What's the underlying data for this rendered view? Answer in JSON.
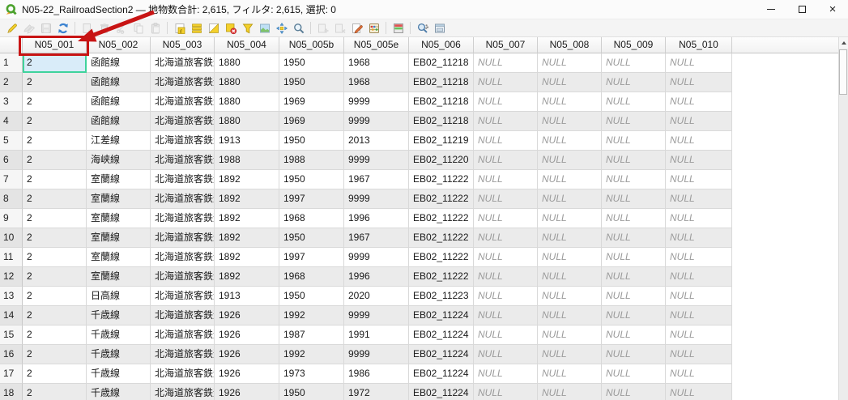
{
  "window": {
    "title": "N05-22_RailroadSection2 — 地物数合計: 2,615, フィルタ: 2,615, 選択: 0",
    "app_icon": "qgis-logo-icon"
  },
  "toolbar": {
    "buttons": [
      {
        "id": "toggle-editing-mode",
        "icon": "pencil",
        "enabled": true
      },
      {
        "id": "toggle-multi-edit-mode",
        "icon": "pencil-multi",
        "enabled": false
      },
      {
        "id": "save-edits",
        "icon": "save",
        "enabled": false
      },
      {
        "id": "reload-table",
        "icon": "refresh",
        "enabled": true
      },
      {
        "id": "separator"
      },
      {
        "id": "add-feature",
        "icon": "add-feature",
        "enabled": false
      },
      {
        "id": "delete-selected-features",
        "icon": "trash",
        "enabled": false
      },
      {
        "id": "cut-features",
        "icon": "scissors",
        "enabled": false
      },
      {
        "id": "copy-features",
        "icon": "copy",
        "enabled": false
      },
      {
        "id": "paste-features",
        "icon": "paste",
        "enabled": false
      },
      {
        "id": "separator"
      },
      {
        "id": "select-by-expression",
        "icon": "epsilon",
        "enabled": true
      },
      {
        "id": "select-all",
        "icon": "select-all",
        "enabled": true
      },
      {
        "id": "invert-selection",
        "icon": "invert",
        "enabled": true
      },
      {
        "id": "deselect-all",
        "icon": "deselect",
        "enabled": true
      },
      {
        "id": "filter-features",
        "icon": "funnel",
        "enabled": true
      },
      {
        "id": "move-selection-to-top",
        "icon": "map",
        "enabled": true
      },
      {
        "id": "pan-map-to-selected",
        "icon": "pan",
        "enabled": true
      },
      {
        "id": "zoom-map-to-selected",
        "icon": "magnifier",
        "enabled": true
      },
      {
        "id": "separator"
      },
      {
        "id": "new-field",
        "icon": "field-add",
        "enabled": false
      },
      {
        "id": "delete-field",
        "icon": "field-delete",
        "enabled": false
      },
      {
        "id": "edit-field",
        "icon": "pencil-paper",
        "enabled": true
      },
      {
        "id": "field-calculator",
        "icon": "abacus",
        "enabled": true
      },
      {
        "id": "separator"
      },
      {
        "id": "conditional-formatting",
        "icon": "cond-format",
        "enabled": true
      },
      {
        "id": "separator"
      },
      {
        "id": "actions",
        "icon": "magnifier-gear",
        "enabled": true
      },
      {
        "id": "dock-attribute-table",
        "icon": "dock",
        "enabled": true
      }
    ]
  },
  "table": {
    "columns": [
      "N05_001",
      "N05_002",
      "N05_003",
      "N05_004",
      "N05_005b",
      "N05_005e",
      "N05_006",
      "N05_007",
      "N05_008",
      "N05_009",
      "N05_010"
    ],
    "null_display": "NULL",
    "rows": [
      {
        "num": "1",
        "cells": [
          "2",
          "函館線",
          "北海道旅客鉄道...",
          "1880",
          "1950",
          "1968",
          "EB02_11218",
          "NULL",
          "NULL",
          "NULL",
          "NULL"
        ]
      },
      {
        "num": "2",
        "cells": [
          "2",
          "函館線",
          "北海道旅客鉄道...",
          "1880",
          "1950",
          "1968",
          "EB02_11218",
          "NULL",
          "NULL",
          "NULL",
          "NULL"
        ]
      },
      {
        "num": "3",
        "cells": [
          "2",
          "函館線",
          "北海道旅客鉄道...",
          "1880",
          "1969",
          "9999",
          "EB02_11218",
          "NULL",
          "NULL",
          "NULL",
          "NULL"
        ]
      },
      {
        "num": "4",
        "cells": [
          "2",
          "函館線",
          "北海道旅客鉄道...",
          "1880",
          "1969",
          "9999",
          "EB02_11218",
          "NULL",
          "NULL",
          "NULL",
          "NULL"
        ]
      },
      {
        "num": "5",
        "cells": [
          "2",
          "江差線",
          "北海道旅客鉄道...",
          "1913",
          "1950",
          "2013",
          "EB02_11219",
          "NULL",
          "NULL",
          "NULL",
          "NULL"
        ]
      },
      {
        "num": "6",
        "cells": [
          "2",
          "海峡線",
          "北海道旅客鉄道...",
          "1988",
          "1988",
          "9999",
          "EB02_11220",
          "NULL",
          "NULL",
          "NULL",
          "NULL"
        ]
      },
      {
        "num": "7",
        "cells": [
          "2",
          "室蘭線",
          "北海道旅客鉄道...",
          "1892",
          "1950",
          "1967",
          "EB02_11222",
          "NULL",
          "NULL",
          "NULL",
          "NULL"
        ]
      },
      {
        "num": "8",
        "cells": [
          "2",
          "室蘭線",
          "北海道旅客鉄道...",
          "1892",
          "1997",
          "9999",
          "EB02_11222",
          "NULL",
          "NULL",
          "NULL",
          "NULL"
        ]
      },
      {
        "num": "9",
        "cells": [
          "2",
          "室蘭線",
          "北海道旅客鉄道...",
          "1892",
          "1968",
          "1996",
          "EB02_11222",
          "NULL",
          "NULL",
          "NULL",
          "NULL"
        ]
      },
      {
        "num": "10",
        "cells": [
          "2",
          "室蘭線",
          "北海道旅客鉄道...",
          "1892",
          "1950",
          "1967",
          "EB02_11222",
          "NULL",
          "NULL",
          "NULL",
          "NULL"
        ]
      },
      {
        "num": "11",
        "cells": [
          "2",
          "室蘭線",
          "北海道旅客鉄道...",
          "1892",
          "1997",
          "9999",
          "EB02_11222",
          "NULL",
          "NULL",
          "NULL",
          "NULL"
        ]
      },
      {
        "num": "12",
        "cells": [
          "2",
          "室蘭線",
          "北海道旅客鉄道...",
          "1892",
          "1968",
          "1996",
          "EB02_11222",
          "NULL",
          "NULL",
          "NULL",
          "NULL"
        ]
      },
      {
        "num": "13",
        "cells": [
          "2",
          "日高線",
          "北海道旅客鉄道...",
          "1913",
          "1950",
          "2020",
          "EB02_11223",
          "NULL",
          "NULL",
          "NULL",
          "NULL"
        ]
      },
      {
        "num": "14",
        "cells": [
          "2",
          "千歳線",
          "北海道旅客鉄道...",
          "1926",
          "1992",
          "9999",
          "EB02_11224",
          "NULL",
          "NULL",
          "NULL",
          "NULL"
        ]
      },
      {
        "num": "15",
        "cells": [
          "2",
          "千歳線",
          "北海道旅客鉄道...",
          "1926",
          "1987",
          "1991",
          "EB02_11224",
          "NULL",
          "NULL",
          "NULL",
          "NULL"
        ]
      },
      {
        "num": "16",
        "cells": [
          "2",
          "千歳線",
          "北海道旅客鉄道...",
          "1926",
          "1992",
          "9999",
          "EB02_11224",
          "NULL",
          "NULL",
          "NULL",
          "NULL"
        ]
      },
      {
        "num": "17",
        "cells": [
          "2",
          "千歳線",
          "北海道旅客鉄道...",
          "1926",
          "1973",
          "1986",
          "EB02_11224",
          "NULL",
          "NULL",
          "NULL",
          "NULL"
        ]
      },
      {
        "num": "18",
        "cells": [
          "2",
          "千歳線",
          "北海道旅客鉄道...",
          "1926",
          "1950",
          "1972",
          "EB02_11224",
          "NULL",
          "NULL",
          "NULL",
          "NULL"
        ]
      }
    ]
  },
  "selection": {
    "row_index": 0,
    "column": "N05_001",
    "value": "2"
  },
  "annotation": {
    "highlighted_column": "N05_001"
  },
  "colors": {
    "annotation_red": "#c81414",
    "selection_border": "#3fd39c",
    "selection_fill": "#d9ecf9",
    "row_alt": "#ebebeb",
    "toolbar_yellow": "#f4d02c",
    "toolbar_blue": "#3b82d0"
  }
}
